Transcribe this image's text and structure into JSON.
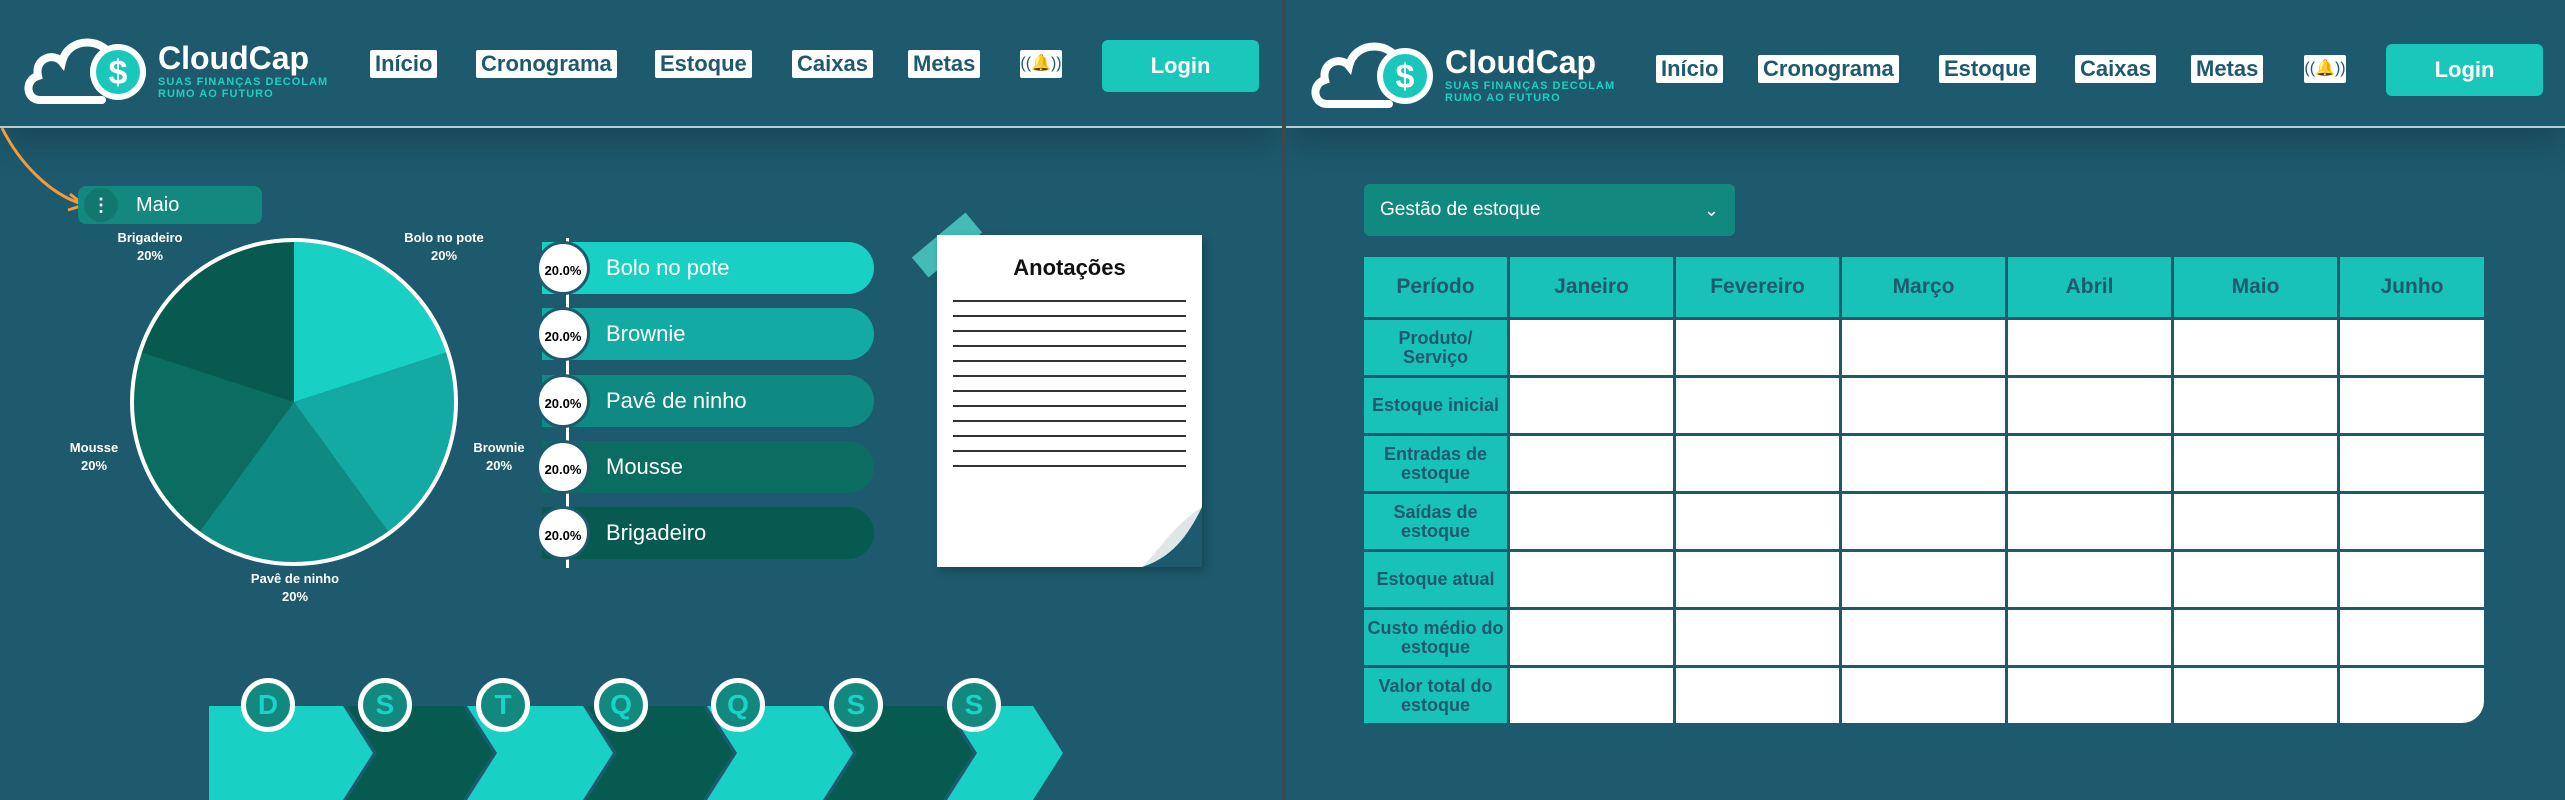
{
  "left": {
    "header": {
      "brand": "CloudCap",
      "tagline": "SUAS FINANÇAS DECOLAM RUMO AO FUTURO",
      "nav": [
        "Início",
        "Cronograma",
        "Estoque",
        "Caixas",
        "Metas"
      ],
      "bell_icon": "bell-icon",
      "login": "Login"
    },
    "month_selector": {
      "label": "Maio"
    },
    "pie_labels": [
      {
        "name": "Bolo no pote",
        "pct": "20%"
      },
      {
        "name": "Brownie",
        "pct": "20%"
      },
      {
        "name": "Pavê de ninho",
        "pct": "20%"
      },
      {
        "name": "Mousse",
        "pct": "20%"
      },
      {
        "name": "Brigadeiro",
        "pct": "20%"
      }
    ],
    "legend": [
      {
        "pct": "20.0%",
        "label": "Bolo no pote",
        "color": "#19d0c4"
      },
      {
        "pct": "20.0%",
        "label": "Brownie",
        "color": "#12aaa2"
      },
      {
        "pct": "20.0%",
        "label": "Pavê de ninho",
        "color": "#0f8a82"
      },
      {
        "pct": "20.0%",
        "label": "Mousse",
        "color": "#0b6d62"
      },
      {
        "pct": "20.0%",
        "label": "Brigadeiro",
        "color": "#075a4f"
      }
    ],
    "notes": {
      "title": "Anotações"
    },
    "weekdays": [
      "D",
      "S",
      "T",
      "Q",
      "Q",
      "S",
      "S"
    ]
  },
  "right": {
    "header": {
      "brand": "CloudCap",
      "tagline": "SUAS FINANÇAS DECOLAM RUMO AO FUTURO",
      "nav": [
        "Início",
        "Cronograma",
        "Estoque",
        "Caixas",
        "Metas"
      ],
      "bell_icon": "bell-icon",
      "login": "Login"
    },
    "select": {
      "label": "Gestão de estoque"
    },
    "table": {
      "corner": "Período",
      "months": [
        "Janeiro",
        "Fevereiro",
        "Março",
        "Abril",
        "Maio",
        "Junho"
      ],
      "rows": [
        "Produto/ Serviço",
        "Estoque inicial",
        "Entradas de estoque",
        "Saídas de estoque",
        "Estoque atual",
        "Custo médio do estoque",
        "Valor total do estoque"
      ]
    }
  },
  "chart_data": {
    "type": "pie",
    "categories": [
      "Bolo no pote",
      "Brownie",
      "Pavê de ninho",
      "Mousse",
      "Brigadeiro"
    ],
    "values": [
      20,
      20,
      20,
      20,
      20
    ],
    "colors": [
      "#19d0c4",
      "#12aaa2",
      "#0f8a82",
      "#0b6d62",
      "#075a4f"
    ]
  }
}
